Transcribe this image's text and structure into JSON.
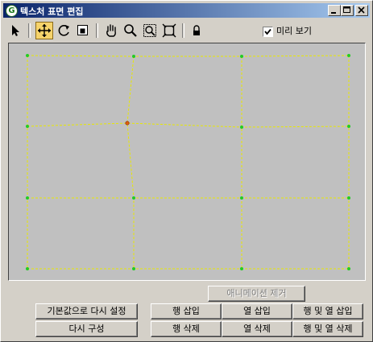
{
  "window": {
    "title": "텍스처 표면 편집",
    "app_icon_letter": "G",
    "controls": [
      "minimize-icon",
      "maximize-icon",
      "close-icon"
    ]
  },
  "toolbar": {
    "tools": [
      {
        "name": "select-arrow-icon",
        "active": false
      },
      {
        "name": "move-icon",
        "active": true
      },
      {
        "name": "rotate-icon",
        "active": false
      },
      {
        "name": "scale-icon",
        "active": false
      },
      {
        "name": "pan-hand-icon",
        "active": false
      },
      {
        "name": "zoom-icon",
        "active": false
      },
      {
        "name": "zoom-region-icon",
        "active": false
      },
      {
        "name": "zoom-extents-icon",
        "active": false
      },
      {
        "name": "lock-icon",
        "active": false
      }
    ],
    "preview_label": "미리 보기",
    "preview_checked": true
  },
  "canvas": {
    "grid_color": "#e8e800",
    "vertex_color": "#22cc22",
    "selected_vertex_color": "#e06010",
    "background": "#c0c0c0"
  },
  "buttons": {
    "remove_animation": "애니메이션 제거",
    "reset_default": "기본값으로 다시 설정",
    "reconfigure": "다시 구성",
    "insert_row": "행 삽입",
    "insert_column": "열 삽입",
    "insert_row_column": "행 및 열 삽입",
    "delete_row": "행 삭제",
    "delete_column": "열 삭제",
    "delete_row_column": "행 및 열 삭제"
  }
}
